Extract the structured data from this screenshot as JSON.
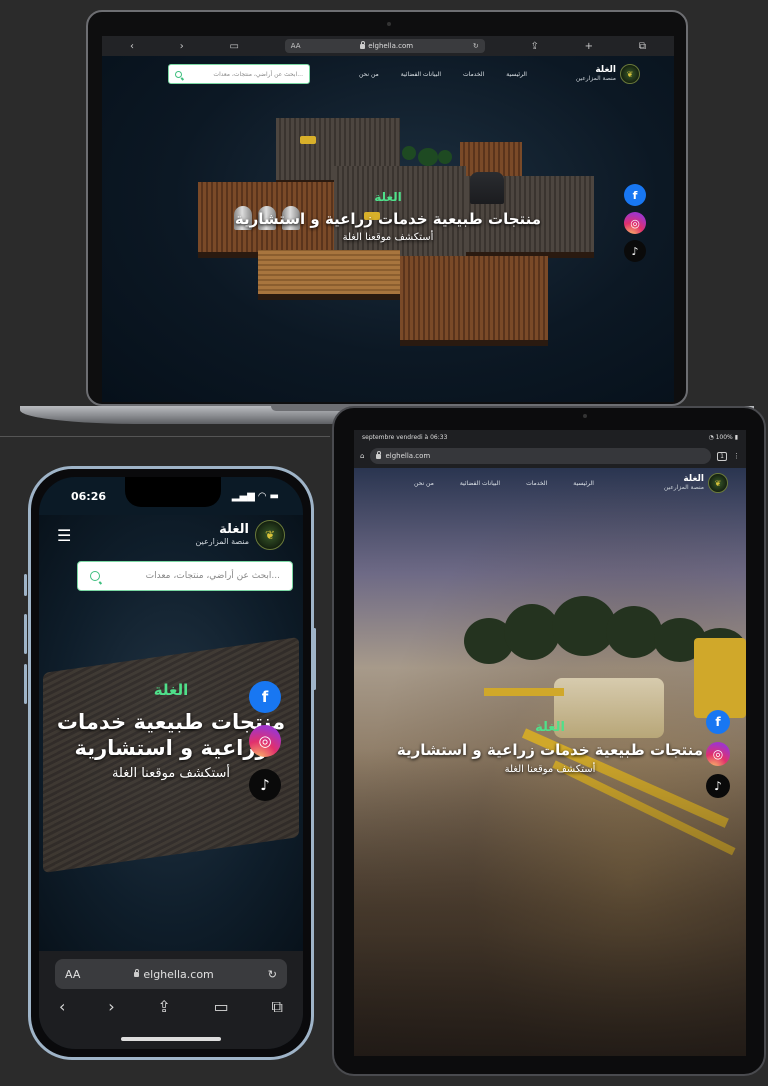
{
  "site": {
    "brand": "الغلة",
    "tagline": "منصة المزارعين",
    "menu": [
      "الرئيسية",
      "الخدمات",
      "البيانات الفضائية",
      "من نحن"
    ],
    "search_placeholder": "ابحث عن أراضي، منتجات، معدات...",
    "hero_brand": "الغلة",
    "hero_headline": "منتجات طبيعية خدمات زراعية و استشارية",
    "hero_cta": "أستكشف موقعنا الغلة",
    "social": [
      "facebook-icon",
      "instagram-icon",
      "tiktok-icon"
    ],
    "colors": {
      "accent": "#4fe08a",
      "facebook": "#1877f2",
      "tiktok": "#0a0a0a"
    }
  },
  "laptop": {
    "browser": {
      "text_size": "AA",
      "url": "elghella.com",
      "icons": [
        "back-icon",
        "forward-icon",
        "bookmarks-icon",
        "reload-icon",
        "share-icon",
        "new-tab-icon",
        "tabs-icon"
      ]
    }
  },
  "phone": {
    "time": "06:26",
    "url_text_size": "AA",
    "url": "elghella.com",
    "toolbar_icons": [
      "back-icon",
      "forward-icon",
      "share-icon",
      "bookmarks-icon",
      "tabs-icon"
    ]
  },
  "tablet": {
    "status_left": "septembre vendredi à 06:33",
    "battery": "100%",
    "url": "elghella.com",
    "tab_count": "1"
  }
}
